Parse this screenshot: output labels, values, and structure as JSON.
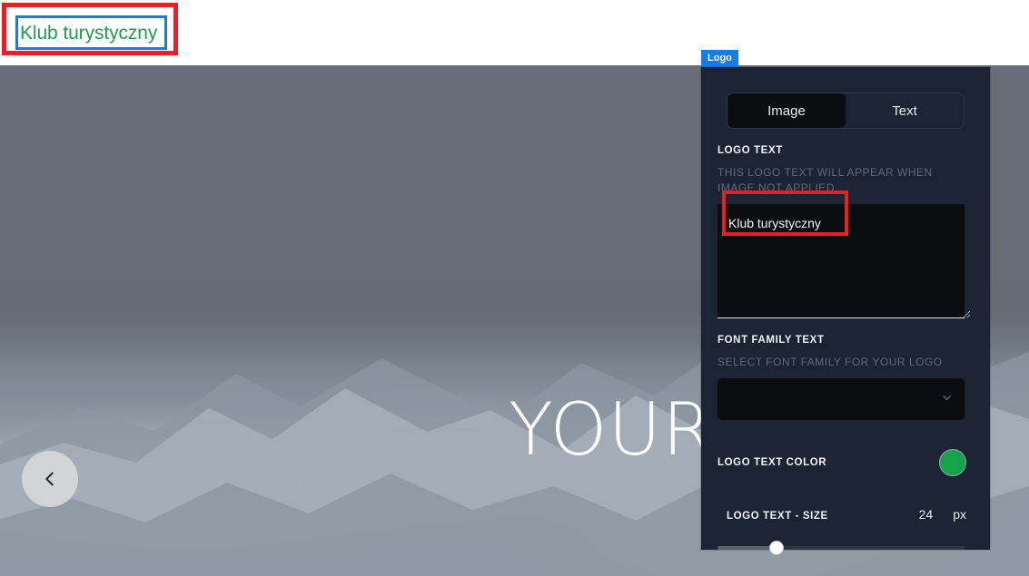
{
  "preview": {
    "logo_text": "Klub turystyczny",
    "logo_text_color": "#1f9e4d",
    "annotation_outer_color": "#ee1c25",
    "annotation_inner_color": "#1a7ae8"
  },
  "hero": {
    "title": "YOUR GREAT",
    "prev_arrow_icon": "chevron-left-icon"
  },
  "panel": {
    "badge": "Logo",
    "badge_color": "#1a7ae8",
    "tabs": [
      {
        "label": "Image",
        "active": true
      },
      {
        "label": "Text",
        "active": false
      }
    ],
    "logo_text_field": {
      "label": "LOGO TEXT",
      "description": "THIS LOGO TEXT WILL APPEAR WHEN IMAGE NOT APPLIED",
      "value": "Klub turystyczny",
      "placeholder": ""
    },
    "font_family_field": {
      "label": "FONT FAMILY TEXT",
      "description": "SELECT FONT FAMILY FOR YOUR LOGO",
      "value": "",
      "chevron_icon": "chevron-down-icon"
    },
    "color_field": {
      "label": "LOGO TEXT COLOR",
      "value": "#15a34a"
    },
    "size_field": {
      "label": "LOGO TEXT - SIZE",
      "value": "24",
      "unit": "px",
      "slider_percent": 24
    }
  }
}
